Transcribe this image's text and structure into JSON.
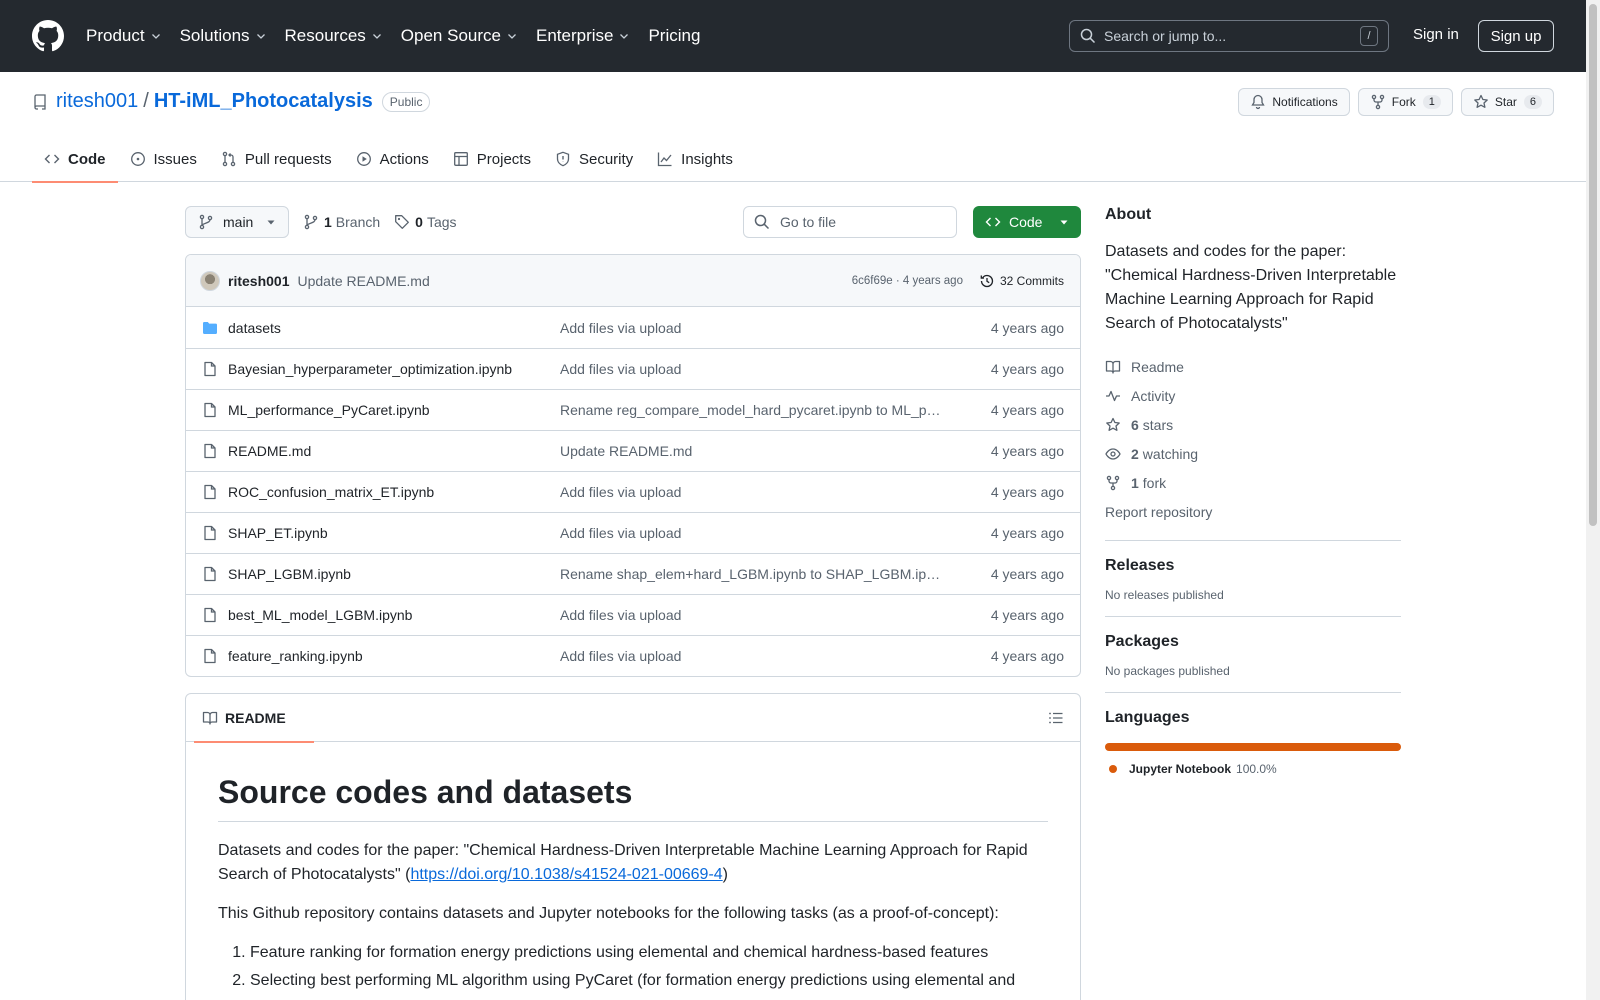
{
  "header": {
    "nav": [
      "Product",
      "Solutions",
      "Resources",
      "Open Source",
      "Enterprise",
      "Pricing"
    ],
    "search_placeholder": "Search or jump to...",
    "search_shortcut": "/",
    "sign_in": "Sign in",
    "sign_up": "Sign up"
  },
  "repo": {
    "owner": "ritesh001",
    "separator": "/",
    "name": "HT-iML_Photocatalysis",
    "visibility": "Public",
    "notifications_label": "Notifications",
    "fork_label": "Fork",
    "fork_count": "1",
    "star_label": "Star",
    "star_count": "6",
    "tabs": [
      "Code",
      "Issues",
      "Pull requests",
      "Actions",
      "Projects",
      "Security",
      "Insights"
    ]
  },
  "toolbar": {
    "branch": "main",
    "branch_count": "1",
    "branch_label": "Branch",
    "tag_count": "0",
    "tag_label": "Tags",
    "goto_placeholder": "Go to file",
    "code_button": "Code"
  },
  "commit": {
    "author": "ritesh001",
    "message": "Update README.md",
    "sha_time": "6c6f69e · 4 years ago",
    "commits": "32 Commits"
  },
  "files": [
    {
      "type": "dir",
      "name": "datasets",
      "message": "Add files via upload",
      "time": "4 years ago"
    },
    {
      "type": "file",
      "name": "Bayesian_hyperparameter_optimization.ipynb",
      "message": "Add files via upload",
      "time": "4 years ago"
    },
    {
      "type": "file",
      "name": "ML_performance_PyCaret.ipynb",
      "message": "Rename reg_compare_model_hard_pycaret.ipynb to ML_p…",
      "time": "4 years ago"
    },
    {
      "type": "file",
      "name": "README.md",
      "message": "Update README.md",
      "time": "4 years ago"
    },
    {
      "type": "file",
      "name": "ROC_confusion_matrix_ET.ipynb",
      "message": "Add files via upload",
      "time": "4 years ago"
    },
    {
      "type": "file",
      "name": "SHAP_ET.ipynb",
      "message": "Add files via upload",
      "time": "4 years ago"
    },
    {
      "type": "file",
      "name": "SHAP_LGBM.ipynb",
      "message": "Rename shap_elem+hard_LGBM.ipynb to SHAP_LGBM.ip…",
      "time": "4 years ago"
    },
    {
      "type": "file",
      "name": "best_ML_model_LGBM.ipynb",
      "message": "Add files via upload",
      "time": "4 years ago"
    },
    {
      "type": "file",
      "name": "feature_ranking.ipynb",
      "message": "Add files via upload",
      "time": "4 years ago"
    }
  ],
  "readme": {
    "tab": "README",
    "title": "Source codes and datasets",
    "p1_text": "Datasets and codes for the paper: \"Chemical Hardness-Driven Interpretable Machine Learning Approach for Rapid Search of Photocatalysts\" (",
    "p1_link": "https://doi.org/10.1038/s41524-021-00669-4",
    "p1_end": ")",
    "p2": "This Github repository contains datasets and Jupyter notebooks for the following tasks (as a proof-of-concept):",
    "list": [
      "Feature ranking for formation energy predictions using elemental and chemical hardness-based features",
      "Selecting best performing ML algorithm using PyCaret (for formation energy predictions using elemental and"
    ]
  },
  "about": {
    "title": "About",
    "description": "Datasets and codes for the paper: \"Chemical Hardness-Driven Interpretable Machine Learning Approach for Rapid Search of Photocatalysts\"",
    "readme": "Readme",
    "activity": "Activity",
    "stars_count": "6",
    "stars_label": "stars",
    "watching_count": "2",
    "watching_label": "watching",
    "forks_count": "1",
    "forks_label": "fork",
    "report": "Report repository"
  },
  "releases": {
    "title": "Releases",
    "empty": "No releases published"
  },
  "packages": {
    "title": "Packages",
    "empty": "No packages published"
  },
  "languages": {
    "title": "Languages",
    "items": [
      {
        "name": "Jupyter Notebook",
        "percent": "100.0%",
        "color": "#da5b0b",
        "share": 1.0
      }
    ]
  }
}
